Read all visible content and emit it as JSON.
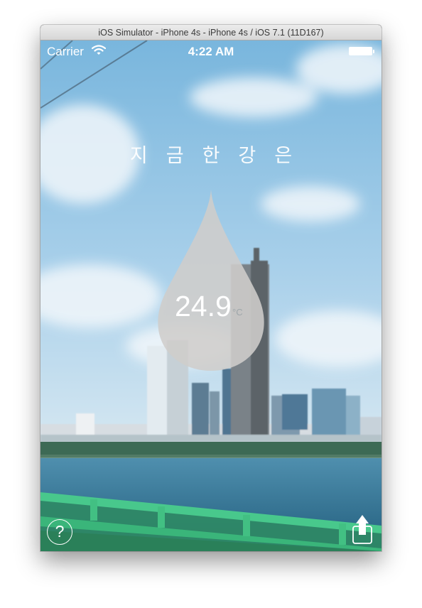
{
  "window": {
    "title": "iOS Simulator - iPhone 4s - iPhone 4s / iOS 7.1 (11D167)"
  },
  "status_bar": {
    "carrier": "Carrier",
    "time": "4:22 AM",
    "wifi_icon": "wifi-icon",
    "battery_icon": "battery-icon"
  },
  "main": {
    "heading": "지금한강은",
    "temperature": "24.9",
    "unit": "°C",
    "drop_icon": "water-drop-icon"
  },
  "toolbar": {
    "help_label": "?",
    "help_icon": "help-icon",
    "share_icon": "share-icon"
  },
  "colors": {
    "drop": "#c8c6c4",
    "railing": "#3fbf85",
    "river": "#2f6e8c",
    "sky": "#9cc8e6"
  }
}
